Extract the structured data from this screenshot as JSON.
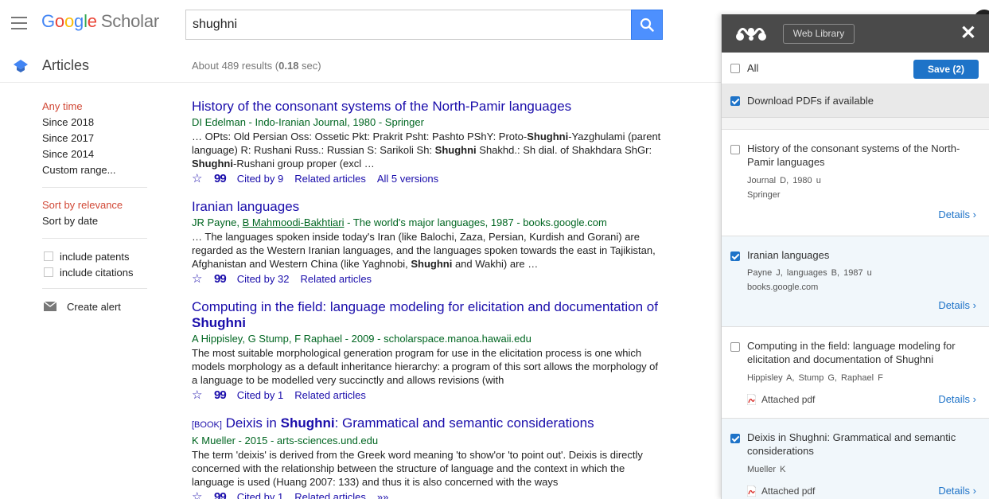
{
  "header": {
    "menu_icon": "hamburger-icon",
    "logo_google": [
      "G",
      "o",
      "o",
      "g",
      "l",
      "e"
    ],
    "logo_scholar": "Scholar",
    "search_value": "shughni",
    "search_icon": "search-icon"
  },
  "subheader": {
    "section_label": "Articles",
    "results_prefix": "About 489 results (",
    "results_time": "0.18",
    "results_suffix": " sec)"
  },
  "sidebar": {
    "time_filters": [
      "Any time",
      "Since 2018",
      "Since 2017",
      "Since 2014",
      "Custom range..."
    ],
    "sort_options": [
      "Sort by relevance",
      "Sort by date"
    ],
    "checkboxes": [
      "include patents",
      "include citations"
    ],
    "create_alert": "Create alert"
  },
  "results": [
    {
      "title": "History of the consonant systems of the North-Pamir languages",
      "meta": "DI Edelman - Indo-Iranian Journal, 1980 - Springer",
      "snippet_html": "… OPts: Old Persian Oss: Ossetic Pkt: Prakrit Psht: Pashto PShY: Proto-<b>Shughni</b>-Yazghulami (parent language) R: Rushani Russ.: Russian S: Sarikoli Sh: <b>Shughni</b> Shakhd.: Sh dial. of Shakhdara ShGr: <b>Shughni</b>-Rushani group proper (excl …",
      "cited_by": "Cited by 9",
      "related": "Related articles",
      "versions": "All 5 versions"
    },
    {
      "title": "Iranian languages",
      "meta_prefix": "JR Payne, ",
      "meta_link": "B Mahmoodi-Bakhtiari",
      "meta_suffix": " - The world's major languages, 1987 - books.google.com",
      "snippet_html": "… The languages spoken inside today's Iran (like Balochi, Zaza, Persian, Kurdish and Gorani) are regarded as the Western Iranian languages, and the languages spoken towards the east in Tajikistan, Afghanistan and Western China (like Yaghnobi, <b>Shughni</b> and Wakhi) are …",
      "cited_by": "Cited by 32",
      "related": "Related articles"
    },
    {
      "title_html": "Computing in the field: language modeling for elicitation and documentation of <b>Shughni</b>",
      "meta": "A Hippisley, G Stump, F Raphael - 2009 - scholarspace.manoa.hawaii.edu",
      "snippet_html": "The most suitable morphological generation program for use in the elicitation process is one which models morphology as a default inheritance hierarchy: a program of this sort allows the morphology of a language to be modelled very succinctly and allows revisions (with",
      "cited_by": "Cited by 1",
      "related": "Related articles"
    },
    {
      "book_tag": "[BOOK]",
      "title_html": "Deixis in <b>Shughni</b>: Grammatical and semantic considerations",
      "meta": "K Mueller - 2015 - arts-sciences.und.edu",
      "snippet_html": "The term 'deixis' is derived from the Greek word meaning 'to show'or 'to point out'. Deixis is directly concerned with the relationship between the structure of language and the context in which the language is used (Huang 2007: 133) and thus it is also concerned with the ways",
      "cited_by": "Cited by 1",
      "related": "Related articles",
      "more": "»»"
    }
  ],
  "panel": {
    "web_library": "Web Library",
    "close": "✕",
    "all_label": "All",
    "save_label": "Save (2)",
    "download_label": "Download PDFs if available",
    "download_checked": true,
    "entries": [
      {
        "title": "History of the consonant systems of the North-Pamir languages",
        "meta1": "Journal D,  1980 u",
        "meta2": "Springer",
        "checked": false,
        "details": "Details ›"
      },
      {
        "title": "Iranian languages",
        "meta1": "Payne J,  languages B,  1987 u",
        "meta2": "books.google.com",
        "checked": true,
        "details": "Details ›"
      },
      {
        "title": "Computing in the field: language modeling for elicitation and documentation of Shughni",
        "meta1": "Hippisley A,  Stump G,  Raphael F",
        "pdf": "Attached pdf",
        "checked": false,
        "details": "Details ›"
      },
      {
        "title": "Deixis in Shughni: Grammatical and semantic considerations",
        "meta1": "Mueller K",
        "pdf": "Attached pdf",
        "checked": true,
        "details": "Details ›"
      }
    ]
  },
  "colors": {
    "link": "#1a0dab",
    "meta_green": "#006621",
    "active_filter": "#d14836",
    "search_button": "#4d90fe",
    "mendeley_header": "#4a4a4a",
    "mendeley_blue": "#1e73c8"
  }
}
